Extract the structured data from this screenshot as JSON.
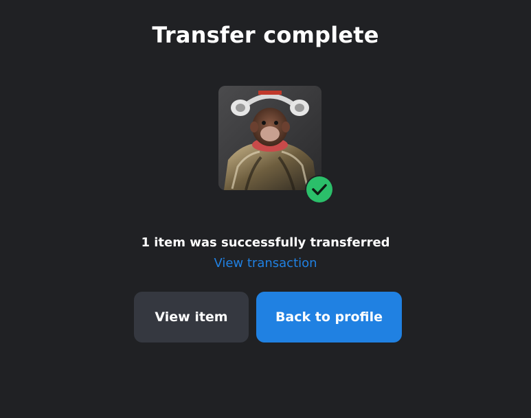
{
  "modal": {
    "title": "Transfer complete",
    "message": "1 item was successfully transferred",
    "link_label": "View transaction",
    "buttons": {
      "view_item": "View item",
      "back_to_profile": "Back to profile"
    },
    "nft_image": "nft-ape-with-headphones-image",
    "status_icon": "check-circle-icon"
  },
  "colors": {
    "background": "#202124",
    "primary": "#2081e2",
    "secondary": "#353840",
    "success": "#2bbf6a"
  }
}
